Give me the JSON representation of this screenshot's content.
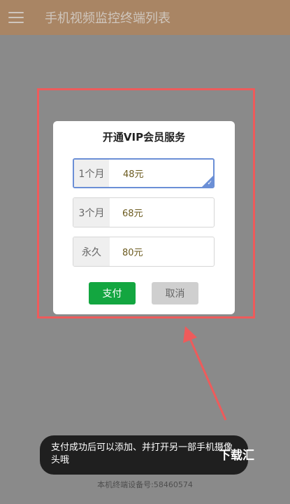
{
  "appbar": {
    "title": "手机视频监控终端列表",
    "menu_icon": "hamburger-menu-icon"
  },
  "dialog": {
    "title": "开通VIP会员服务",
    "plans": [
      {
        "label": "1个月",
        "price": "48元",
        "selected": true
      },
      {
        "label": "3个月",
        "price": "68元",
        "selected": false
      },
      {
        "label": "永久",
        "price": "80元",
        "selected": false
      }
    ],
    "pay_label": "支付",
    "cancel_label": "取消",
    "colors": {
      "pay": "#13a640",
      "highlight": "#ee5b5b",
      "selected_border": "#6b8fd6"
    }
  },
  "toast": {
    "text": "支付成功后可以添加、并打开另一部手机摄像头哦"
  },
  "watermark": "下载汇",
  "footer": {
    "device_id": "本机终端设备号:58460574"
  }
}
